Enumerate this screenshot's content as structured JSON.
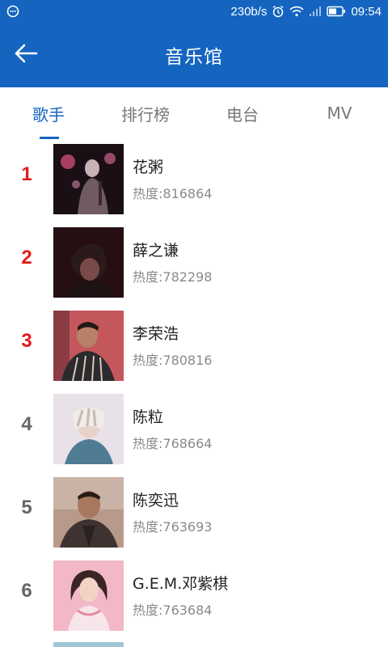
{
  "status_bar": {
    "speed": "230b/s",
    "time": "09:54"
  },
  "app_bar": {
    "title": "音乐馆"
  },
  "tabs": [
    {
      "label": "歌手",
      "active": true
    },
    {
      "label": "排行榜",
      "active": false
    },
    {
      "label": "电台",
      "active": false
    },
    {
      "label": "MV",
      "active": false
    }
  ],
  "artists": [
    {
      "rank": "1",
      "name": "花粥",
      "heat": "热度:816864"
    },
    {
      "rank": "2",
      "name": "薛之谦",
      "heat": "热度:782298"
    },
    {
      "rank": "3",
      "name": "李荣浩",
      "heat": "热度:780816"
    },
    {
      "rank": "4",
      "name": "陈粒",
      "heat": "热度:768664"
    },
    {
      "rank": "5",
      "name": "陈奕迅",
      "heat": "热度:763693"
    },
    {
      "rank": "6",
      "name": "G.E.M.邓紫棋",
      "heat": "热度:763684"
    }
  ],
  "colors": {
    "primary": "#1565c0",
    "top_rank": "#e21b1b",
    "rank": "#666666"
  }
}
